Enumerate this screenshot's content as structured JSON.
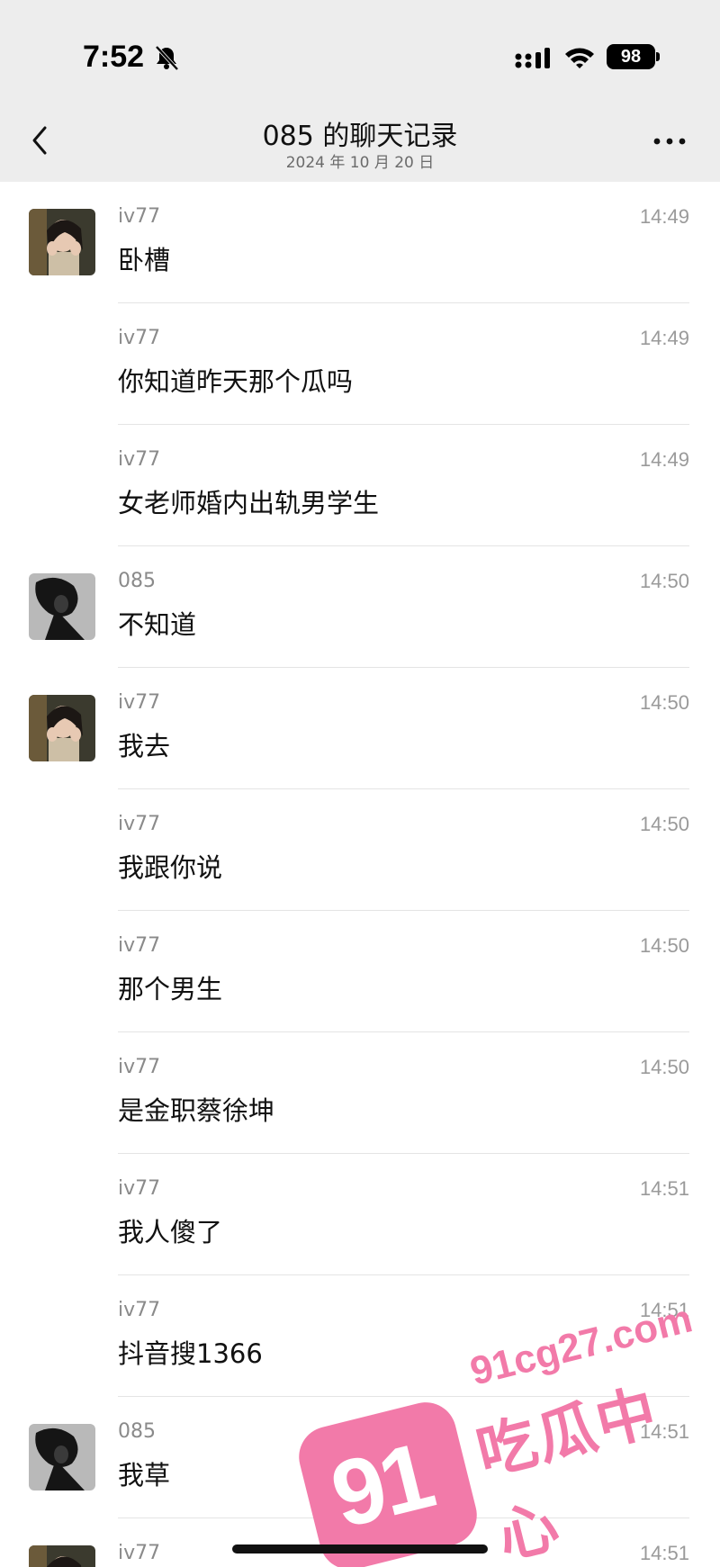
{
  "status_bar": {
    "time": "7:52",
    "battery": "98"
  },
  "header": {
    "title": "085 的聊天记录",
    "subtitle": "2024 年 10 月 20 日"
  },
  "messages": [
    {
      "sender": "iv77",
      "time": "14:49",
      "text": "卧槽",
      "avatar": "iv77"
    },
    {
      "sender": "iv77",
      "time": "14:49",
      "text": "你知道昨天那个瓜吗"
    },
    {
      "sender": "iv77",
      "time": "14:49",
      "text": "女老师婚内出轨男学生"
    },
    {
      "sender": "085",
      "time": "14:50",
      "text": "不知道",
      "avatar": "085"
    },
    {
      "sender": "iv77",
      "time": "14:50",
      "text": "我去",
      "avatar": "iv77"
    },
    {
      "sender": "iv77",
      "time": "14:50",
      "text": "我跟你说"
    },
    {
      "sender": "iv77",
      "time": "14:50",
      "text": "那个男生"
    },
    {
      "sender": "iv77",
      "time": "14:50",
      "text": "是金职蔡徐坤"
    },
    {
      "sender": "iv77",
      "time": "14:51",
      "text": "我人傻了"
    },
    {
      "sender": "iv77",
      "time": "14:51",
      "text": "抖音搜1366"
    },
    {
      "sender": "085",
      "time": "14:51",
      "text": "我草",
      "avatar": "085"
    },
    {
      "sender": "iv77",
      "time": "14:51",
      "text": "",
      "avatar": "iv77"
    }
  ],
  "watermark": {
    "badge": "91",
    "domain": "91cg27.com",
    "name": "吃瓜中心"
  },
  "icons": {
    "back": "chevron-left-icon",
    "more": "more-icon",
    "bell": "bell-slash-icon",
    "signal": "signal-icon",
    "wifi": "wifi-icon"
  },
  "colors": {
    "bar_bg": "#ededed",
    "watermark": "#f27aa9"
  }
}
